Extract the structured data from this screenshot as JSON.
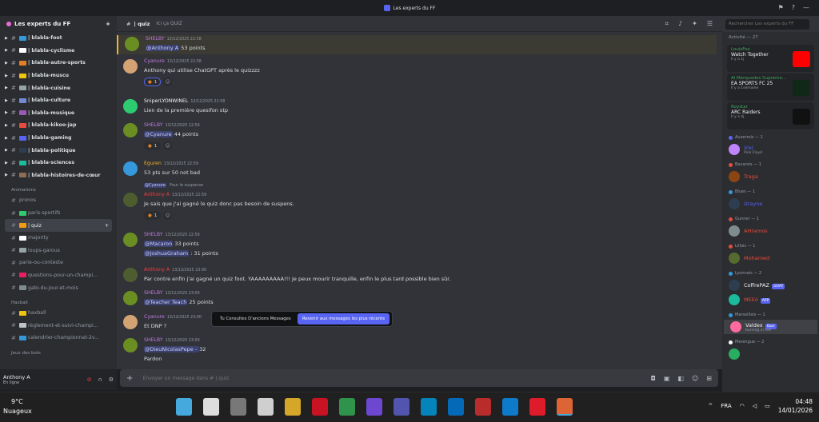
{
  "window": {
    "title": "Les experts du FF"
  },
  "server": {
    "name": "Les experts du FF"
  },
  "channels": [
    {
      "label": "| blabla-foot",
      "color": "#3498db",
      "bold": true
    },
    {
      "label": "| blabla-cyclisme",
      "color": "#ffffff",
      "bold": true
    },
    {
      "label": "| blabla-autre-sports",
      "color": "#e67e22",
      "bold": true
    },
    {
      "label": "| blabla-muscu",
      "color": "#f1c40f",
      "bold": true
    },
    {
      "label": "| blabla-cuisine",
      "color": "#95a5a6",
      "bold": true
    },
    {
      "label": "| blabla-culture",
      "color": "#7289da",
      "bold": true
    },
    {
      "label": "| blabla-musique",
      "color": "#9b59b6",
      "bold": true
    },
    {
      "label": "| blabla-kikoo-jap",
      "color": "#e74c3c",
      "bold": true
    },
    {
      "label": "| blabla-gaming",
      "color": "#5865f2",
      "bold": true
    },
    {
      "label": "| blabla-politique",
      "color": "#2c3e50",
      "bold": true
    },
    {
      "label": "| blabla-sciences",
      "color": "#1abc9c",
      "bold": true
    },
    {
      "label": "| blabla-histoires-de-cœur",
      "color": "#8e6e53",
      "bold": true
    }
  ],
  "category_animations": "Animations",
  "anim_channels": [
    {
      "label": "pronos",
      "color": ""
    },
    {
      "label": "paris-sportifs",
      "color": "#2ecc71"
    },
    {
      "label": "| quiz",
      "color": "#f39c12",
      "active": true
    },
    {
      "label": "majority",
      "color": "#ffffff"
    },
    {
      "label": "loups-garous",
      "color": "#95a5a6"
    },
    {
      "label": "parie-ou-conteste",
      "color": ""
    },
    {
      "label": "questions-pour-un-champi...",
      "color": "#e91e63"
    },
    {
      "label": "gabi-du-jour-et-mois",
      "color": "#7f8c8d"
    }
  ],
  "category_haxball": "Haxball",
  "hax_channels": [
    {
      "label": "haxball",
      "color": "#f1c40f"
    },
    {
      "label": "règlement-et-suivi-champi...",
      "color": "#bdc3c7"
    },
    {
      "label": "calendrier-championnat-2v...",
      "color": "#3498db"
    }
  ],
  "category_bots": "Jeux des bots",
  "user": {
    "name": "Anthony A",
    "status": "En ligne"
  },
  "chat_header": {
    "channel": "| quiz",
    "topic": "Ici ça QUIZ"
  },
  "search": {
    "placeholder": "Rechercher Les experts du FF"
  },
  "messages": [
    {
      "author": "SHELBY",
      "color": "#c07be0",
      "time": "13/12/2025 22:58",
      "text_mention": "@Anthony A",
      "text": " 53 points",
      "avatar": "#6b8e23"
    },
    {
      "author": "Cyanure",
      "color": "#c07be0",
      "time": "13/12/2025 22:58",
      "text": "Anthony qui utilise ChatGPT après le quizzzz",
      "reaction": "1",
      "avatar": "#d4a373"
    },
    {
      "author": "SniperLYONWINEL",
      "color": "#f2f3f5",
      "time": "13/12/2025 22:58",
      "text": "Lien de la première quesifon stp",
      "avatar": "#2ecc71"
    },
    {
      "author": "SHELBY",
      "color": "#c07be0",
      "time": "13/12/2025 22:59",
      "text_mention": "@Cyanure",
      "text": " 44 points",
      "reaction": "1",
      "avatar": "#6b8e23"
    },
    {
      "author": "Eguren",
      "color": "#f0b232",
      "time": "13/12/2025 22:59",
      "text": "53 pts sur 50 not bad",
      "avatar": "#3498db"
    },
    {
      "reply_to": "@Cyanure",
      "reply_text": "Pour le suspense",
      "author": "Anthony A",
      "color": "#f23f43",
      "time": "13/12/2025 22:59",
      "text": "Je sais que j'ai gagné le quiz donc pas besoin de suspens.",
      "reaction": "1",
      "avatar": "#4e5d2f"
    },
    {
      "author": "SHELBY",
      "color": "#c07be0",
      "time": "13/12/2025 22:59",
      "text_mention": "@Macaron",
      "text": " 33 points",
      "line2_mention": "@JoshuaGraham",
      "line2": " : 31 points",
      "avatar": "#6b8e23"
    },
    {
      "author": "Anthony A",
      "color": "#f23f43",
      "time": "13/12/2025 23:00",
      "text": "Par contre enfin j'ai gagné un quiz foot. YAAAAAAAAA!!! Je peux mourir tranquille, enfin le plus tard possible bien sûr.",
      "avatar": "#4e5d2f"
    },
    {
      "author": "SHELBY",
      "color": "#c07be0",
      "time": "13/12/2025 23:00",
      "text_mention": "@Teacher Teach",
      "text": " 25 points",
      "avatar": "#6b8e23"
    },
    {
      "author": "Cyanure",
      "color": "#c07be0",
      "time": "13/12/2025 23:00",
      "text": "Et DNP ?",
      "avatar": "#d4a373"
    },
    {
      "author": "SHELBY",
      "color": "#c07be0",
      "time": "13/12/2025 23:00",
      "text_mention": "@DieuNicolasPepe - ",
      "text": " 32",
      "line2": "Pardon",
      "avatar": "#6b8e23"
    }
  ],
  "jump": {
    "text": "Tu Consultes D'anciens Messages",
    "button": "Revenir aux messages les plus récents"
  },
  "composer": {
    "placeholder": "Envoyer un message dans # | quiz"
  },
  "activity": {
    "title": "Activité — 27",
    "cards": [
      {
        "who": "LouisFox",
        "what": "Watch Together",
        "when": "Il y a 1j",
        "thumb": "#ff0000"
      },
      {
        "who": "Al Merquades Supreme...",
        "what": "EA SPORTS FC 25",
        "when": "Il y a 1semaine",
        "thumb": "#0f2818"
      },
      {
        "who": "Roystar",
        "what": "ARC Raiders",
        "when": "Il y a 4j",
        "thumb": "#111111"
      }
    ]
  },
  "members": [
    {
      "group": "Auxerrois — 1",
      "gcolor": "#5865f2",
      "name": "Vixl",
      "sub": "Pink Floyd",
      "ncolor": "#5865f2",
      "avatar": "#c084fc"
    },
    {
      "group": "Bavarois — 1",
      "gcolor": "#e74c3c",
      "name": "Traga",
      "ncolor": "#e74c3c",
      "avatar": "#8b4513"
    },
    {
      "group": "Blues — 1",
      "gcolor": "#3498db",
      "name": "Urayne",
      "ncolor": "#5865f2",
      "avatar": "#2c3e50"
    },
    {
      "group": "Gunner — 1",
      "gcolor": "#e74c3c",
      "name": "AHramos",
      "ncolor": "#e74c3c",
      "avatar": "#7f8c8d"
    },
    {
      "group": "Lillois — 1",
      "gcolor": "#e74c3c",
      "name": "Mohamed",
      "ncolor": "#e74c3c",
      "avatar": "#556b2f"
    },
    {
      "group": "Lyonnais — 2",
      "gcolor": "#3498db",
      "name": "CoffrePAZ",
      "tag": "GOAT",
      "ncolor": "#f2f3f5",
      "avatar": "#2c3e50"
    },
    {
      "group": "",
      "gcolor": "",
      "name": "MEEó",
      "tag": "APP",
      "ncolor": "#e74c3c",
      "avatar": "#1abc9c"
    },
    {
      "group": "Marseillais — 1",
      "gcolor": "#3498db",
      "name": "Valdex",
      "tag": "kbar",
      "sub": "burning in hell",
      "ncolor": "#f2f3f5",
      "avatar": "#ff6b9d"
    },
    {
      "group": "Merengue — 2",
      "gcolor": "#ffffff",
      "name": "",
      "ncolor": "#f2f3f5",
      "avatar": "#27ae60"
    }
  ],
  "taskbar": {
    "temp": "9°C",
    "weather": "Nuageux",
    "lang": "FRA",
    "time": "04:48",
    "date": "14/01/2026"
  }
}
